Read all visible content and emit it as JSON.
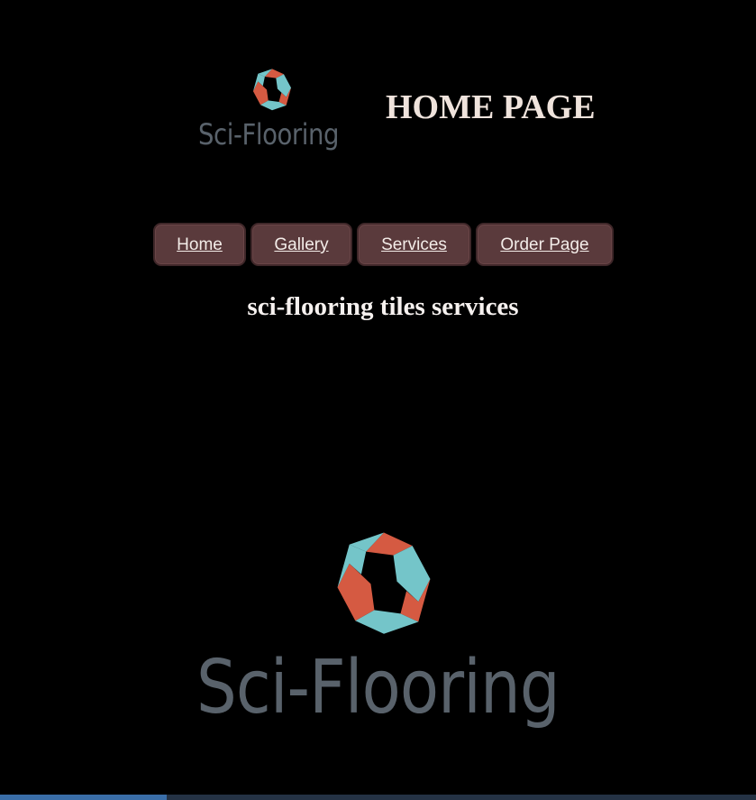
{
  "header": {
    "logo_text": "Sci-Flooring",
    "page_title": "HOME PAGE"
  },
  "nav": {
    "items": [
      {
        "label": "Home"
      },
      {
        "label": "Gallery"
      },
      {
        "label": "Services"
      },
      {
        "label": "Order Page"
      }
    ]
  },
  "main": {
    "subtitle": "sci-flooring tiles services",
    "hero_logo_text": "Sci-Flooring"
  },
  "icons": {
    "logo_mark": "hexagon-knot-icon"
  },
  "colors": {
    "background": "#000000",
    "button_fill": "#5a3a3c",
    "logo_red": "#d55a42",
    "logo_teal": "#74c5c9",
    "logo_text": "#59626b"
  }
}
